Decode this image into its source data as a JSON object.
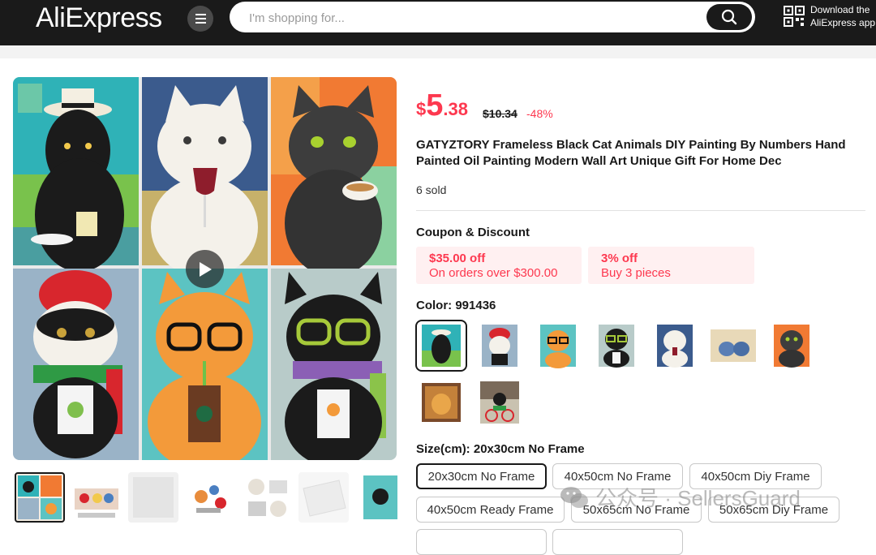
{
  "header": {
    "logo": "AliExpress",
    "search_placeholder": "I'm shopping for...",
    "download_line1": "Download the",
    "download_line2": "AliExpress app"
  },
  "product": {
    "price_currency": "$",
    "price_int": "5",
    "price_dec": ".38",
    "old_price": "$10.34",
    "discount": "-48%",
    "title": "GATYZTORY Frameless Black Cat Animals DIY Painting By Numbers Hand Painted Oil Painting Modern Wall Art Unique Gift For Home Dec",
    "sold": "6 sold"
  },
  "coupons": {
    "label": "Coupon & Discount",
    "items": [
      {
        "title": "$35.00 off",
        "sub": "On orders over $300.00"
      },
      {
        "title": "3% off",
        "sub": "Buy 3 pieces"
      }
    ]
  },
  "color": {
    "label": "Color: 991436",
    "swatch_count": 9,
    "selected_index": 0
  },
  "size": {
    "label": "Size(cm): 20x30cm No Frame",
    "options": [
      "20x30cm No Frame",
      "40x50cm No Frame",
      "40x50cm Diy Frame",
      "40x50cm Ready Frame",
      "50x65cm No Frame",
      "50x65cm Diy Frame"
    ],
    "selected_index": 0
  },
  "watermark": "公众号 · SellersGuard",
  "colors": {
    "accent": "#fd384f",
    "header_bg": "#1a1a1a",
    "coupon_bg": "#fff0f1"
  }
}
